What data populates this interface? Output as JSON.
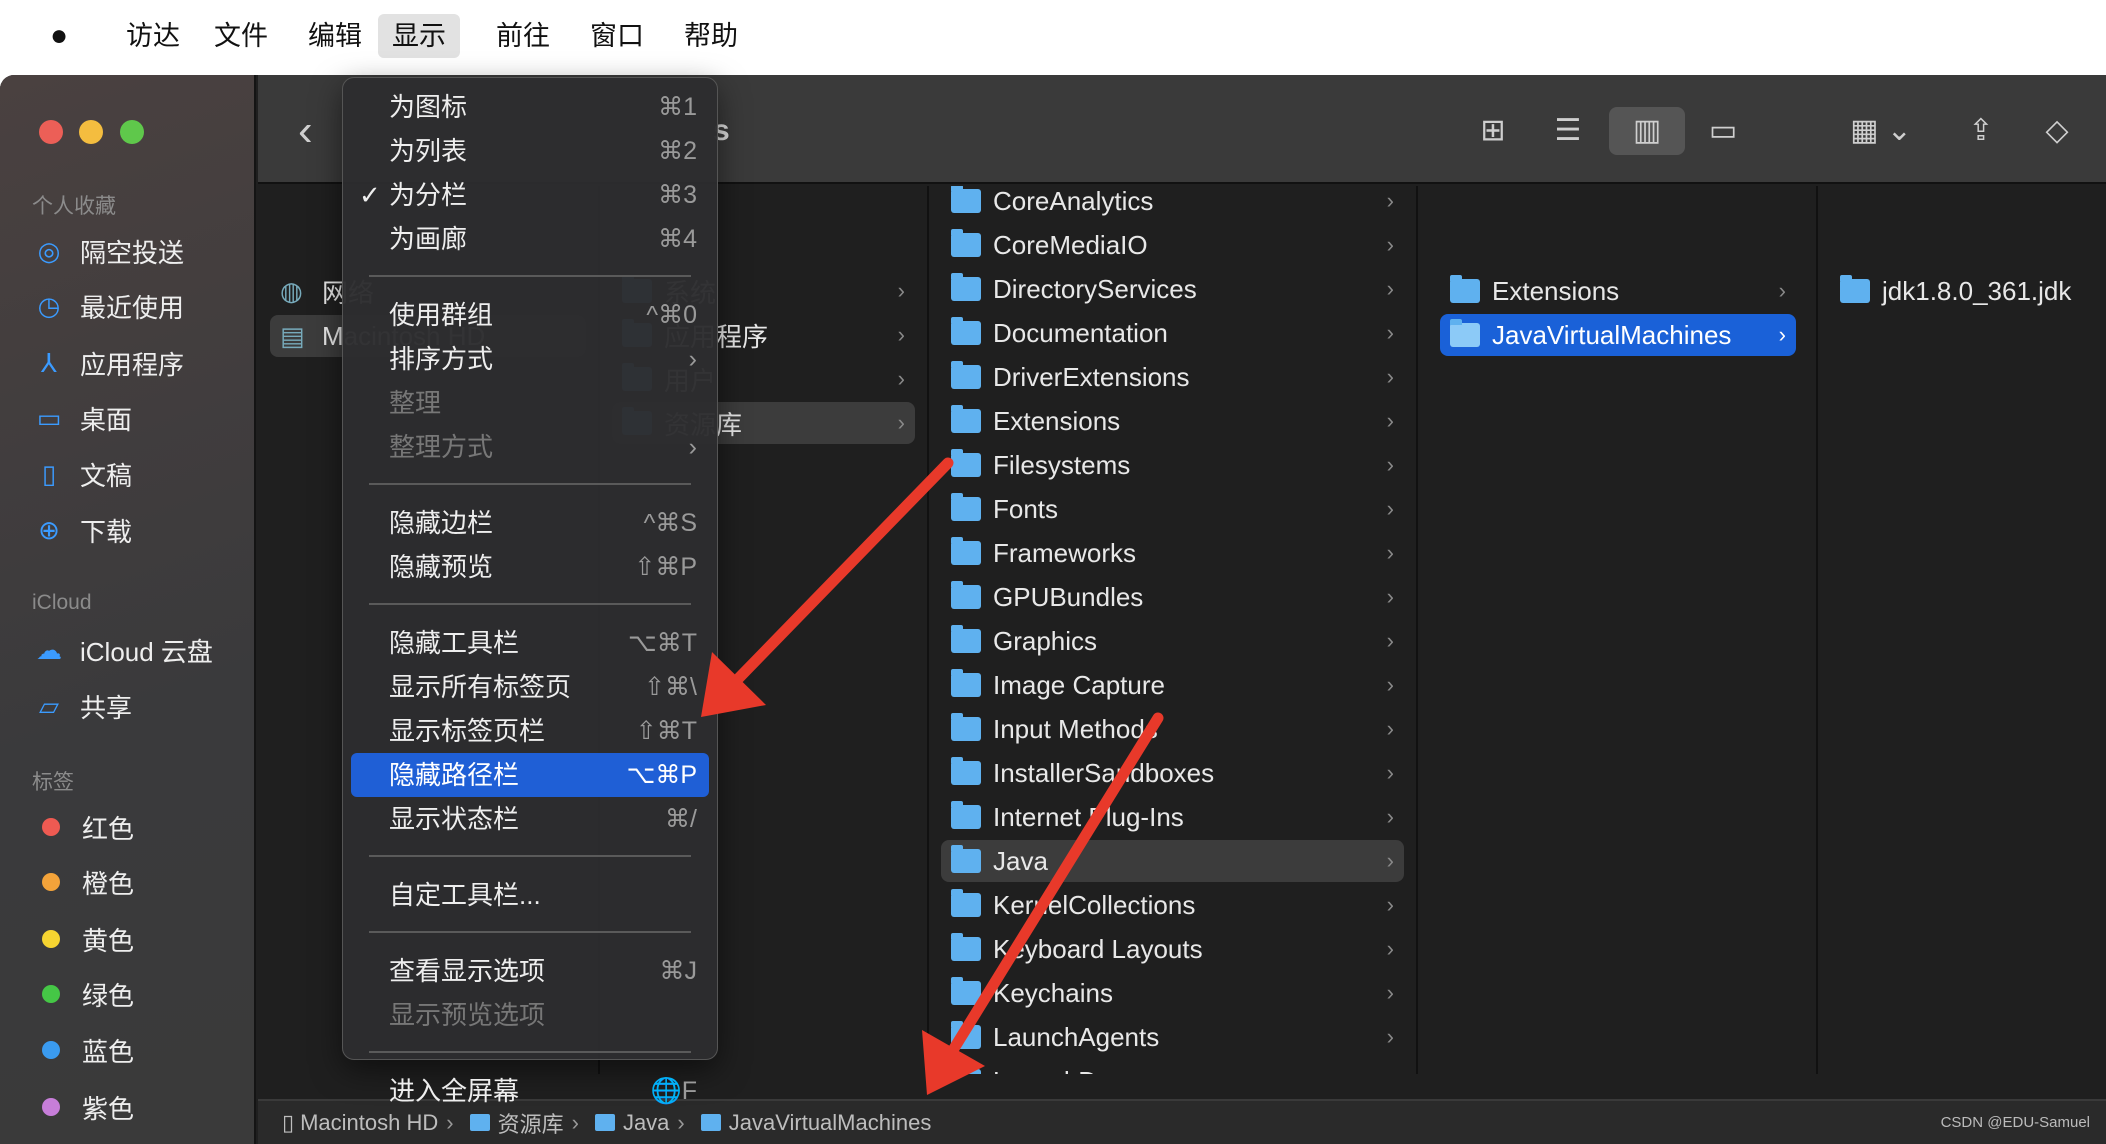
{
  "menubar": {
    "apple": "",
    "items": [
      "访达",
      "文件",
      "编辑",
      "显示",
      "前往",
      "窗口",
      "帮助"
    ],
    "active": "显示"
  },
  "toolbar": {
    "back": "‹",
    "title_partial": "s",
    "view_icons": "grid-view-icon",
    "view_list": "list-view-icon",
    "view_columns": "column-view-icon",
    "view_gallery": "gallery-view-icon",
    "group": "group-icon",
    "share": "share-icon",
    "tag": "tag-icon"
  },
  "sidebar": {
    "favorites_header": "个人收藏",
    "favorites": [
      {
        "label": "隔空投送",
        "icon": "airdrop-icon"
      },
      {
        "label": "最近使用",
        "icon": "clock-icon"
      },
      {
        "label": "应用程序",
        "icon": "applications-icon"
      },
      {
        "label": "桌面",
        "icon": "desktop-icon"
      },
      {
        "label": "文稿",
        "icon": "document-icon"
      },
      {
        "label": "下载",
        "icon": "download-icon"
      }
    ],
    "icloud_header": "iCloud",
    "icloud": [
      {
        "label": "iCloud 云盘",
        "icon": "cloud-icon"
      },
      {
        "label": "共享",
        "icon": "shared-folder-icon"
      }
    ],
    "tags_header": "标签",
    "tags": [
      {
        "label": "红色",
        "color": "#ee5a52"
      },
      {
        "label": "橙色",
        "color": "#f3a33a"
      },
      {
        "label": "黄色",
        "color": "#f5d431"
      },
      {
        "label": "绿色",
        "color": "#45c746"
      },
      {
        "label": "蓝色",
        "color": "#3a9bf0"
      },
      {
        "label": "紫色",
        "color": "#c77ed9"
      }
    ]
  },
  "columns": {
    "col1": [
      {
        "label": "网络"
      },
      {
        "label": "Macintosh HD"
      }
    ],
    "col2": [
      {
        "label": "系统"
      },
      {
        "label": "应用程序"
      },
      {
        "label": "用户"
      },
      {
        "label": "资源库"
      }
    ],
    "col3": [
      "CoreAnalytics",
      "CoreMediaIO",
      "DirectoryServices",
      "Documentation",
      "DriverExtensions",
      "Extensions",
      "Filesystems",
      "Fonts",
      "Frameworks",
      "GPUBundles",
      "Graphics",
      "Image Capture",
      "Input Methods",
      "InstallerSandboxes",
      "Internet Plug-Ins",
      "Java",
      "KernelCollections",
      "Keyboard Layouts",
      "Keychains",
      "LaunchAgents",
      "LaunchDaemons"
    ],
    "col3_selected": "Java",
    "col4": [
      "Extensions",
      "JavaVirtualMachines"
    ],
    "col4_selected": "JavaVirtualMachines",
    "col5": [
      "jdk1.8.0_361.jdk"
    ]
  },
  "menu": {
    "items": [
      {
        "label": "为图标",
        "shortcut": "⌘1"
      },
      {
        "label": "为列表",
        "shortcut": "⌘2"
      },
      {
        "label": "为分栏",
        "shortcut": "⌘3",
        "checked": "✓"
      },
      {
        "label": "为画廊",
        "shortcut": "⌘4"
      },
      {
        "sep": true
      },
      {
        "label": "使用群组",
        "shortcut": "^⌘0"
      },
      {
        "label": "排序方式",
        "shortcut": "›"
      },
      {
        "label": "整理",
        "disabled": true
      },
      {
        "label": "整理方式",
        "shortcut": "›",
        "disabled": true
      },
      {
        "sep": true
      },
      {
        "label": "隐藏边栏",
        "shortcut": "^⌘S"
      },
      {
        "label": "隐藏预览",
        "shortcut": "⇧⌘P"
      },
      {
        "sep": true
      },
      {
        "label": "隐藏工具栏",
        "shortcut": "⌥⌘T"
      },
      {
        "label": "显示所有标签页",
        "shortcut": "⇧⌘\\"
      },
      {
        "label": "显示标签页栏",
        "shortcut": "⇧⌘T"
      },
      {
        "label": "隐藏路径栏",
        "shortcut": "⌥⌘P",
        "highlighted": true
      },
      {
        "label": "显示状态栏",
        "shortcut": "⌘/"
      },
      {
        "sep": true
      },
      {
        "label": "自定工具栏...",
        "shortcut": ""
      },
      {
        "sep": true
      },
      {
        "label": "查看显示选项",
        "shortcut": "⌘J"
      },
      {
        "label": "显示预览选项",
        "disabled": true
      },
      {
        "sep": true
      },
      {
        "label": "进入全屏幕",
        "shortcut": "🌐F"
      }
    ]
  },
  "pathbar": {
    "items": [
      "Macintosh HD",
      "资源库",
      "Java",
      "JavaVirtualMachines"
    ],
    "watermark": "CSDN @EDU-Samuel"
  },
  "colors": {
    "accent": "#1f5fd6",
    "arrow": "#e8392a"
  }
}
